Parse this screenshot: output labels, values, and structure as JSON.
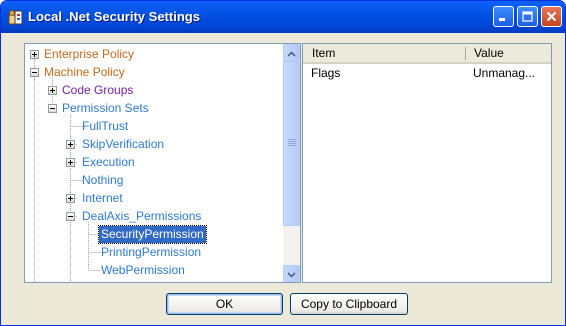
{
  "window": {
    "title": "Local .Net Security Settings"
  },
  "colors": {
    "orange_node": "#c46a1a",
    "purple_node": "#7a1f9c",
    "blue_node": "#2e7ad1",
    "selected_bg": "#316ac5"
  },
  "tree": {
    "nodes": [
      {
        "label": "Enterprise Policy",
        "color": "#c46a1a",
        "expander": "plus"
      },
      {
        "label": "Machine Policy",
        "color": "#c46a1a",
        "expander": "minus"
      },
      {
        "label": "Code Groups",
        "color": "#7a1f9c",
        "expander": "plus"
      },
      {
        "label": "Permission Sets",
        "color": "#2e7ad1",
        "expander": "minus"
      },
      {
        "label": "FullTrust",
        "color": "#2e7ad1",
        "expander": "none"
      },
      {
        "label": "SkipVerification",
        "color": "#2e7ad1",
        "expander": "plus"
      },
      {
        "label": "Execution",
        "color": "#2e7ad1",
        "expander": "plus"
      },
      {
        "label": "Nothing",
        "color": "#2e7ad1",
        "expander": "none"
      },
      {
        "label": "Internet",
        "color": "#2e7ad1",
        "expander": "plus"
      },
      {
        "label": "DealAxis_Permissions",
        "color": "#2e7ad1",
        "expander": "minus"
      },
      {
        "label": "SecurityPermission",
        "color": "#2e7ad1",
        "expander": "none",
        "selected": true
      },
      {
        "label": "PrintingPermission",
        "color": "#2e7ad1",
        "expander": "none"
      },
      {
        "label": "WebPermission",
        "color": "#2e7ad1",
        "expander": "none"
      }
    ]
  },
  "list": {
    "columns": [
      "Item",
      "Value"
    ],
    "rows": [
      {
        "item": "Flags",
        "value": "Unmanag..."
      }
    ]
  },
  "buttons": {
    "ok": "OK",
    "copy": "Copy to Clipboard"
  },
  "icons": {
    "app": "security-shield-icon",
    "minimize": "minimize-icon",
    "maximize": "maximize-icon",
    "close": "close-icon"
  }
}
